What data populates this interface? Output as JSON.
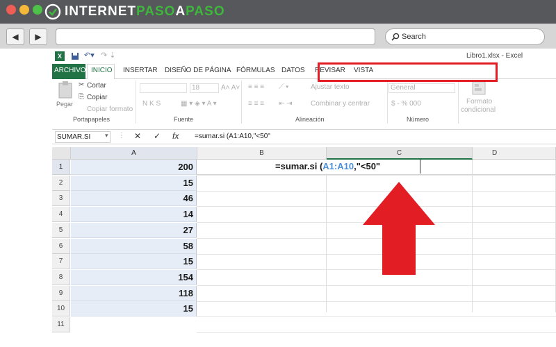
{
  "brand": {
    "text_part1": "INTERNET",
    "text_part2": "PASO",
    "text_part3": "A",
    "text_part4": "PASO"
  },
  "browser": {
    "back_icon": "◀",
    "forward_icon": "▶",
    "search_label": "Search"
  },
  "excel": {
    "file_title": "Libro1.xlsx - Excel",
    "tabs": [
      "ARCHIVO",
      "INICIO",
      "INSERTAR",
      "DISEÑO DE PÁGINA",
      "FÓRMULAS",
      "DATOS",
      "REVISAR",
      "VISTA"
    ],
    "ribbon": {
      "paste_label": "Pegar",
      "cut_label": "Cortar",
      "copy_label": "Copiar",
      "format_painter_label": "Copiar formato",
      "clipboard_group": "Portapapeles",
      "font_group": "Fuente",
      "font_size": "18",
      "bold_italic_underline": "N  K  S",
      "wrap_text": "Ajustar texto",
      "merge_center": "Combinar y centrar",
      "alignment_group": "Alineación",
      "number_format": "General",
      "number_symbols": "$ - % 000",
      "number_group": "Número",
      "conditional_format_line1": "Formato",
      "conditional_format_line2": "condicional"
    },
    "formula_bar": {
      "name_box": "SUMAR.SI",
      "cancel_icon": "✕",
      "enter_icon": "✓",
      "fx": "fx",
      "formula": "=sumar.si (A1:A10,\"<50\""
    },
    "columns": [
      "A",
      "B",
      "C",
      "D"
    ],
    "rows": [
      "1",
      "2",
      "3",
      "4",
      "5",
      "6",
      "7",
      "8",
      "9",
      "10",
      "11"
    ],
    "column_a_values": [
      "200",
      "15",
      "46",
      "14",
      "27",
      "58",
      "15",
      "154",
      "118",
      "15",
      ""
    ],
    "active_cell": {
      "prefix": "=sumar.si (",
      "range": "A1:A10",
      "suffix": ",\"<50\""
    }
  },
  "colors": {
    "accent_red": "#e31d24",
    "range_blue": "#4a8fd9",
    "brand_green": "#3fb63c",
    "excel_green": "#217346"
  }
}
